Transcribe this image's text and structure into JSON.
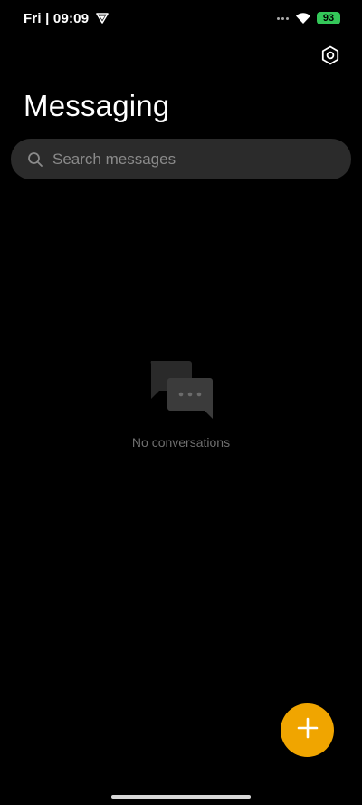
{
  "status_bar": {
    "time": "Fri | 09:09",
    "battery": "93",
    "battery_color": "#34c759"
  },
  "header": {
    "title": "Messaging",
    "settings_icon": "gear-icon"
  },
  "search": {
    "placeholder": "Search messages",
    "value": ""
  },
  "empty_state": {
    "icon": "chat-bubbles-icon",
    "text": "No conversations"
  },
  "fab": {
    "icon": "plus-icon",
    "color": "#f0a500"
  }
}
